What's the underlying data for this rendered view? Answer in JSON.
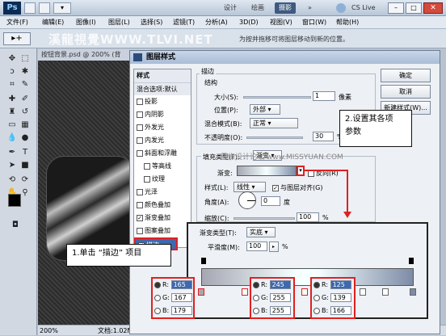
{
  "app": {
    "logo": "Ps",
    "workspace": [
      "设计",
      "绘画",
      "摄影"
    ],
    "active_workspace": "摄影",
    "cslive": "CS Live"
  },
  "menu": [
    "文件(F)",
    "编辑(E)",
    "图像(I)",
    "图层(L)",
    "选择(S)",
    "滤镜(T)",
    "分析(A)",
    "3D(D)",
    "视图(V)",
    "窗口(W)",
    "帮助(H)"
  ],
  "watermark": "溪龍視覺WWW.TLVI.NET",
  "option_hint": "为按并拖移可将图层移动到新的位置。",
  "doc": {
    "tab": "按钮背景.psd @ 200% (背",
    "zoom": "200%",
    "file": "文档:1.02M/4.27M"
  },
  "dialog": {
    "title": "图层样式",
    "list_header": "样式",
    "blend_default": "混合选项:默认",
    "styles": [
      {
        "label": "投影",
        "checked": false
      },
      {
        "label": "内阴影",
        "checked": false
      },
      {
        "label": "外发光",
        "checked": false
      },
      {
        "label": "内发光",
        "checked": false
      },
      {
        "label": "斜面和浮雕",
        "checked": false
      },
      {
        "label": "等高线",
        "checked": false
      },
      {
        "label": "纹理",
        "checked": false
      },
      {
        "label": "光泽",
        "checked": false
      },
      {
        "label": "颜色叠加",
        "checked": false
      },
      {
        "label": "渐变叠加",
        "checked": true
      },
      {
        "label": "图案叠加",
        "checked": false
      },
      {
        "label": "描边",
        "checked": true
      }
    ],
    "buttons": {
      "ok": "确定",
      "cancel": "取消",
      "new_style": "新建样式(W)..."
    },
    "stroke": {
      "heading": "描边",
      "structure": "结构",
      "size_label": "大小(S):",
      "size_value": "1",
      "size_unit": "像素",
      "position_label": "位置(P):",
      "position_value": "外部",
      "blend_label": "混合模式(B):",
      "blend_value": "正常",
      "opacity_label": "不透明度(O):",
      "opacity_value": "30",
      "percent": "%",
      "fill_type_label": "填充类型(F):",
      "fill_type_value": "渐变",
      "gradient_label": "渐变:",
      "reverse_label": "反向(R)",
      "style_label": "样式(L):",
      "style_value": "线性",
      "align_label": "与图层对齐(G)",
      "angle_label": "角度(A):",
      "angle_value": "0",
      "degree": "度",
      "scale_label": "缩放(C):",
      "scale_value": "100"
    },
    "site_watermark": "思缘设计论坛 www.MISSYUAN.COM"
  },
  "gradient_editor": {
    "type_label": "渐变类型(T):",
    "type_value": "实底",
    "smooth_label": "平滑度(M):",
    "smooth_value": "100",
    "percent": "%",
    "stops": [
      {
        "r": "165",
        "g": "167",
        "b": "179"
      },
      {
        "r": "245",
        "g": "255",
        "b": "255"
      },
      {
        "r": "125",
        "g": "139",
        "b": "166"
      }
    ],
    "r_label": "R:",
    "g_label": "G:",
    "b_label": "B:"
  },
  "callouts": {
    "step1": "1.单击 “描边” 项目",
    "step2_line1": "2.设置其各项",
    "step2_line2": "参数"
  },
  "colors": {
    "highlight": "#e02020",
    "title_grad_top": "#c8d6e8"
  }
}
